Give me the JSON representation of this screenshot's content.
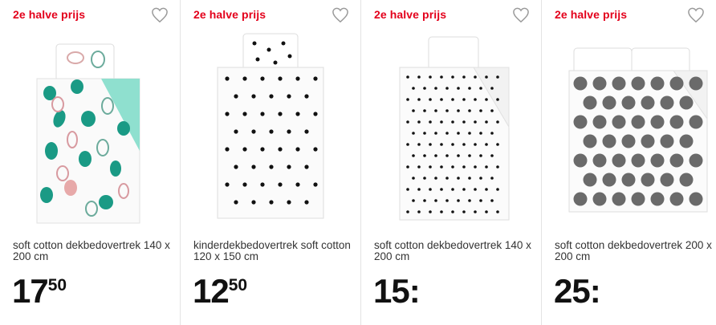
{
  "products": [
    {
      "badge": "2e halve prijs",
      "title": "soft cotton dekbedovertrek 140 x 200 cm",
      "price_whole": "17",
      "price_cents": "50",
      "accent": "#1a9a85",
      "icon": "heart-outline"
    },
    {
      "badge": "2e halve prijs",
      "title": "kinderdekbedovertrek soft cotton 120 x 150 cm",
      "price_whole": "12",
      "price_cents": "50",
      "accent": "#111111",
      "icon": "heart-outline"
    },
    {
      "badge": "2e halve prijs",
      "title": "soft cotton dekbedovertrek 140 x 200 cm",
      "price_whole": "15:",
      "price_cents": "",
      "accent": "#111111",
      "icon": "heart-outline"
    },
    {
      "badge": "2e halve prijs",
      "title": "soft cotton dekbedovertrek 200 x 200 cm",
      "price_whole": "25:",
      "price_cents": "",
      "accent": "#555555",
      "icon": "heart-outline"
    }
  ],
  "colors": {
    "badge": "#e3001b",
    "divider": "#e3e3e3",
    "text": "#333333"
  }
}
